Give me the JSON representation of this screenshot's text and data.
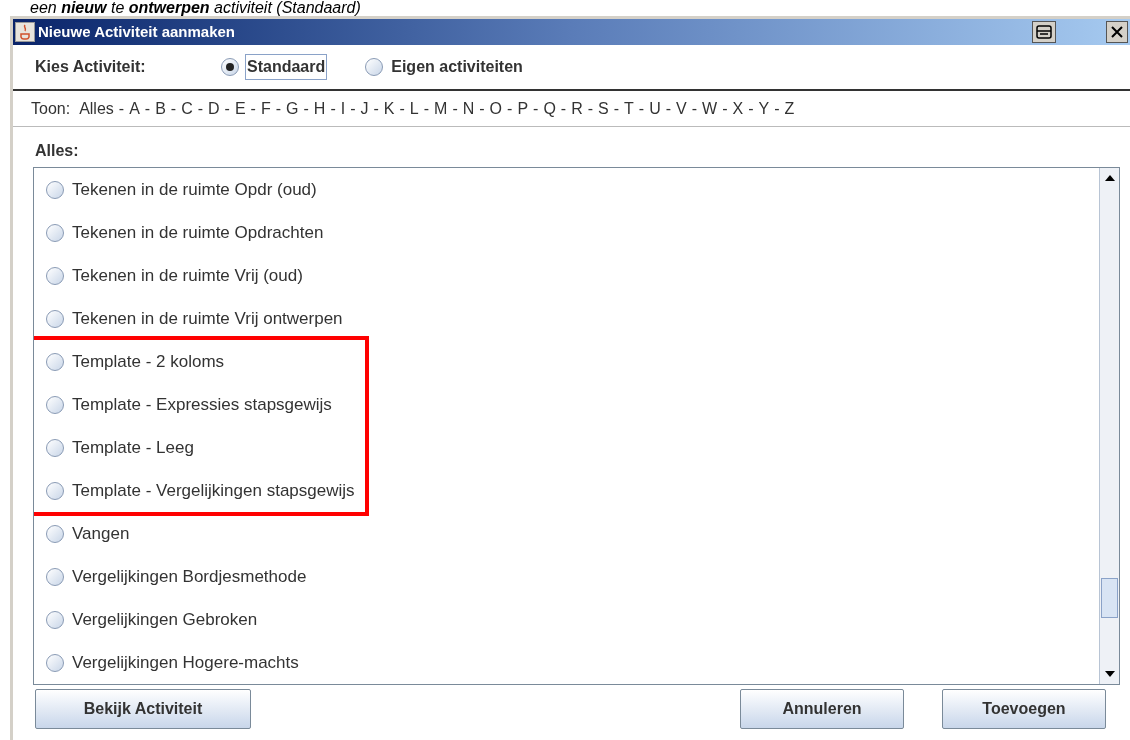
{
  "caption": "een **nieuw** te **ontwerpen** activiteit (Standaard)",
  "window": {
    "title": "Nieuwe Activiteit aanmaken"
  },
  "chooser": {
    "label": "Kies Activiteit:",
    "options": [
      {
        "label": "Standaard",
        "selected": true
      },
      {
        "label": "Eigen activiteiten",
        "selected": false
      }
    ]
  },
  "filter": {
    "label": "Toon:",
    "separator": "-",
    "letters": [
      "Alles",
      "A",
      "B",
      "C",
      "D",
      "E",
      "F",
      "G",
      "H",
      "I",
      "J",
      "K",
      "L",
      "M",
      "N",
      "O",
      "P",
      "Q",
      "R",
      "S",
      "T",
      "U",
      "V",
      "W",
      "X",
      "Y",
      "Z"
    ]
  },
  "list": {
    "heading": "Alles:",
    "items": [
      {
        "label": "Tekenen in de ruimte Opdr (oud)",
        "selected": false,
        "highlighted": false
      },
      {
        "label": "Tekenen in de ruimte Opdrachten",
        "selected": false,
        "highlighted": false
      },
      {
        "label": "Tekenen in de ruimte Vrij (oud)",
        "selected": false,
        "highlighted": false
      },
      {
        "label": "Tekenen in de ruimte Vrij ontwerpen",
        "selected": false,
        "highlighted": false
      },
      {
        "label": "Template - 2 koloms",
        "selected": false,
        "highlighted": true
      },
      {
        "label": "Template - Expressies stapsgewijs",
        "selected": false,
        "highlighted": true
      },
      {
        "label": "Template - Leeg",
        "selected": false,
        "highlighted": true
      },
      {
        "label": "Template - Vergelijkingen stapsgewijs",
        "selected": false,
        "highlighted": true
      },
      {
        "label": "Vangen",
        "selected": false,
        "highlighted": false
      },
      {
        "label": "Vergelijkingen Bordjesmethode",
        "selected": false,
        "highlighted": false
      },
      {
        "label": "Vergelijkingen Gebroken",
        "selected": false,
        "highlighted": false
      },
      {
        "label": "Vergelijkingen Hogere-machts",
        "selected": false,
        "highlighted": false
      }
    ]
  },
  "buttons": {
    "left": [
      "Bekijk Activiteit"
    ],
    "right": [
      "Annuleren",
      "Toevoegen"
    ]
  }
}
